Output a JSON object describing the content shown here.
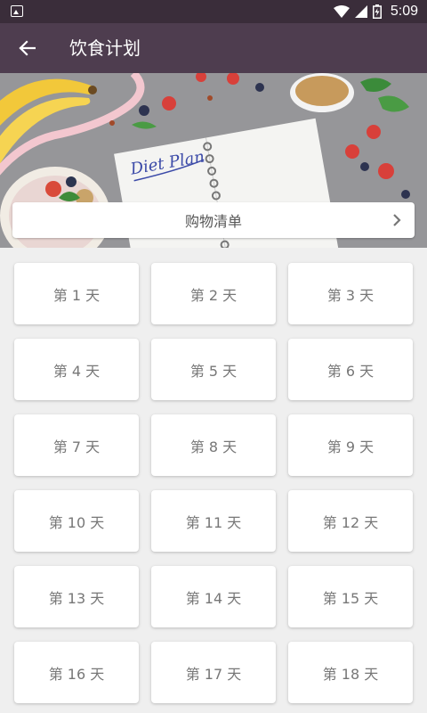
{
  "status_bar": {
    "time": "5:09",
    "icons": [
      "image-notification-icon",
      "wifi-icon",
      "signal-icon",
      "battery-icon"
    ]
  },
  "app_bar": {
    "title": "饮食计划",
    "back_icon": "arrow-left-icon"
  },
  "hero": {
    "notebook_text": "Diet Plan"
  },
  "shopping_list": {
    "label": "购物清单",
    "chevron_icon": "chevron-right-icon"
  },
  "days": [
    {
      "label": "第 1 天"
    },
    {
      "label": "第 2 天"
    },
    {
      "label": "第 3 天"
    },
    {
      "label": "第 4 天"
    },
    {
      "label": "第 5 天"
    },
    {
      "label": "第 6 天"
    },
    {
      "label": "第 7 天"
    },
    {
      "label": "第 8 天"
    },
    {
      "label": "第 9 天"
    },
    {
      "label": "第 10 天"
    },
    {
      "label": "第 11 天"
    },
    {
      "label": "第 12 天"
    },
    {
      "label": "第 13 天"
    },
    {
      "label": "第 14 天"
    },
    {
      "label": "第 15 天"
    },
    {
      "label": "第 16 天"
    },
    {
      "label": "第 17 天"
    },
    {
      "label": "第 18 天"
    }
  ],
  "colors": {
    "status_bar": "#3a2d3a",
    "app_bar": "#4e3d4f",
    "background": "#efefef",
    "card": "#ffffff",
    "card_text": "#777777"
  }
}
